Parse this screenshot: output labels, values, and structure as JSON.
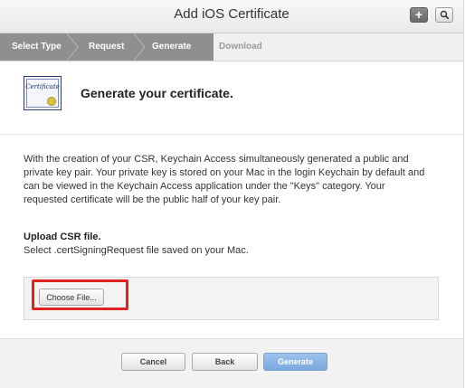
{
  "window": {
    "title": "Add iOS Certificate",
    "add_icon": "plus-icon",
    "search_icon": "search-icon"
  },
  "steps": [
    {
      "label": "Select Type",
      "state": "done"
    },
    {
      "label": "Request",
      "state": "done"
    },
    {
      "label": "Generate",
      "state": "current"
    },
    {
      "label": "Download",
      "state": "pending"
    }
  ],
  "content": {
    "icon_text": "Certificate",
    "heading": "Generate your certificate.",
    "description": "With the creation of your CSR, Keychain Access simultaneously generated a public and private key pair. Your private key is stored on your Mac in the login Keychain by default and can be viewed in the Keychain Access application under the \"Keys\" category. Your requested certificate will be the public half of your key pair.",
    "upload_title": "Upload CSR file.",
    "upload_subtitle": "Select .certSigningRequest file saved on your Mac.",
    "choose_file_label": "Choose File..."
  },
  "footer": {
    "cancel_label": "Cancel",
    "back_label": "Back",
    "generate_label": "Generate"
  },
  "colors": {
    "step_active": "#8f8f8f",
    "primary_button": "#7aa8de",
    "highlight": "#e0231f"
  }
}
